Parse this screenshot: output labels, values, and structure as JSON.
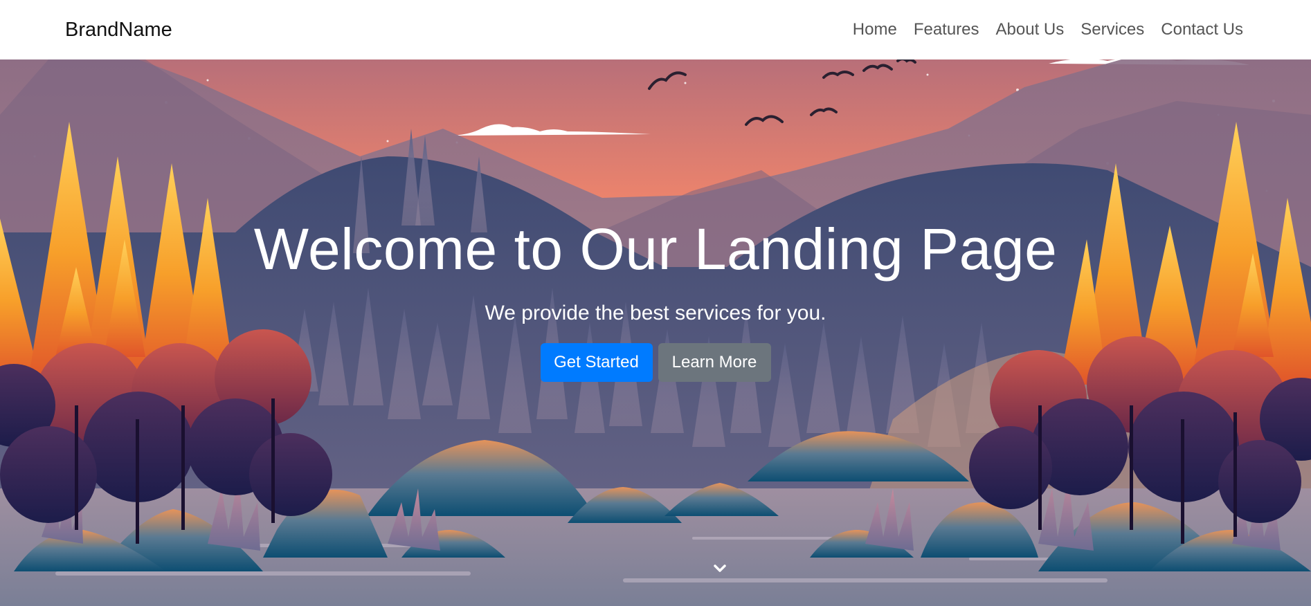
{
  "navbar": {
    "brand": "BrandName",
    "links": [
      "Home",
      "Features",
      "About Us",
      "Services",
      "Contact Us"
    ]
  },
  "hero": {
    "title": "Welcome to Our Landing Page",
    "subtitle": "We provide the best services for you.",
    "primary_button": "Get Started",
    "secondary_button": "Learn More",
    "scroll_icon": "chevron-down-icon"
  },
  "colors": {
    "primary": "#007bff",
    "secondary": "#6c757d",
    "nav_text": "#555555",
    "brand_text": "#111111"
  }
}
